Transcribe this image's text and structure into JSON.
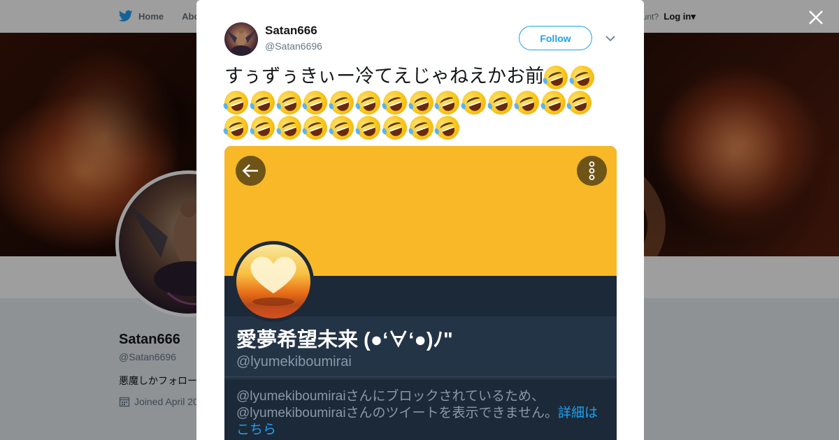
{
  "topbar": {
    "home_label": "Home",
    "about_label": "Abo",
    "account_prompt": "ccount?",
    "login_label": "Log in"
  },
  "profile": {
    "name": "Satan666",
    "handle": "@Satan6696",
    "bio": "悪魔しかフォロー",
    "joined": "Joined April 20"
  },
  "tweet": {
    "author_name": "Satan666",
    "author_handle": "@Satan6696",
    "follow_label": "Follow",
    "text": "すぅずぅきぃー冷てえじゃねえかお前",
    "emoji_name": "rolling-on-the-floor-laughing-emoji",
    "emoji_count": 25
  },
  "embedded_card": {
    "display_name": "愛夢希望未来 (●ʻ∀ʻ●)ﾉ\"",
    "handle": "@lyumekiboumirai",
    "message_line1": "@lyumekiboumiraiさんにブロックされているため、",
    "message_line2": "@lyumekiboumiraiさんのツイートを表示できません。",
    "message_link": "詳細は",
    "message_link2": "こちら"
  },
  "colors": {
    "twitter_blue": "#1da1f2",
    "card_banner": "#f8b828",
    "card_bg": "#1c2938"
  }
}
